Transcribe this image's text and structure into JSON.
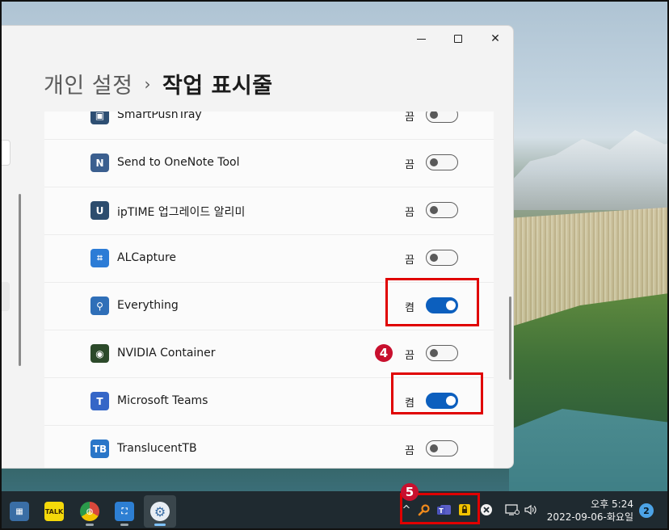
{
  "window": {
    "breadcrumb_parent": "개인 설정",
    "breadcrumb_sep": "›",
    "breadcrumb_current": "작업 표시줄",
    "minimize": "minimize-icon",
    "maximize": "maximize-icon",
    "close": "✕"
  },
  "apps": [
    {
      "name": "SmartPushTray",
      "state": "끔",
      "on": false,
      "icon": "smartpush-icon",
      "color": "#2e4f73",
      "glyph": "▣"
    },
    {
      "name": "Send to OneNote Tool",
      "state": "끔",
      "on": false,
      "icon": "onenote-tool-icon",
      "color": "#3b5f8f",
      "glyph": "N"
    },
    {
      "name": "ipTIME 업그레이드 알리미",
      "state": "끔",
      "on": false,
      "icon": "iptime-icon",
      "color": "#2d4d6e",
      "glyph": "U"
    },
    {
      "name": "ALCapture",
      "state": "끔",
      "on": false,
      "icon": "alcapture-icon",
      "color": "#2c7cd6",
      "glyph": "⌗"
    },
    {
      "name": "Everything",
      "state": "켬",
      "on": true,
      "icon": "everything-icon",
      "color": "#2f6fb8",
      "glyph": "⚲"
    },
    {
      "name": "NVIDIA Container",
      "state": "끔",
      "on": false,
      "icon": "nvidia-icon",
      "color": "#2c4a2a",
      "glyph": "◉"
    },
    {
      "name": "Microsoft Teams",
      "state": "켬",
      "on": true,
      "icon": "teams-icon",
      "color": "#3566c7",
      "glyph": "T"
    },
    {
      "name": "TranslucentTB",
      "state": "끔",
      "on": false,
      "icon": "translucenttb-icon",
      "color": "#2a76c8",
      "glyph": "TB"
    }
  ],
  "annotations": {
    "step4": "4",
    "step5": "5"
  },
  "taskbar": {
    "apps": [
      {
        "icon": "calculator-icon",
        "label": "▦",
        "color": "#3a6ea5"
      },
      {
        "icon": "kakaotalk-icon",
        "label": "TALK",
        "color": "#f5d90a"
      },
      {
        "icon": "chrome-icon",
        "label": "◍",
        "color": "#d9483b"
      },
      {
        "icon": "capture-app-icon",
        "label": "⛶",
        "color": "#2d7fd3"
      },
      {
        "icon": "settings-gear-icon",
        "label": "⚙",
        "color": "#5a7fa8"
      }
    ],
    "tray_chevron": "^",
    "clock_time": "오후 5:24",
    "clock_date": "2022-09-06-화요일",
    "notification_count": "2",
    "tray_icons": [
      "everything-tray-icon",
      "teams-tray-icon",
      "lock-tray-icon",
      "close-circle-icon",
      "display-icon",
      "volume-icon"
    ]
  }
}
